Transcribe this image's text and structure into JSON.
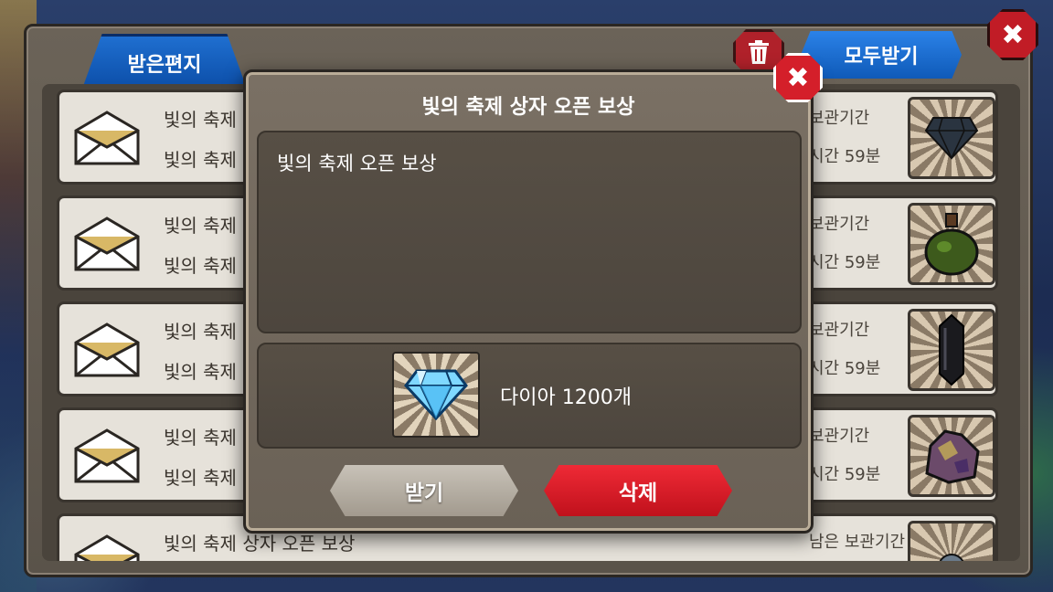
{
  "mailbox": {
    "tab_label": "받은편지",
    "receive_all_label": "모두받기",
    "trash_icon": "trash-icon",
    "close_icon": "close-icon",
    "rows": [
      {
        "title": "빛의 축제",
        "sub": "빛의 축제",
        "keep1": "보관기간",
        "keep2": "시간 59분",
        "item": "dark-gem-icon"
      },
      {
        "title": "빛의 축제",
        "sub": "빛의 축제",
        "keep1": "보관기간",
        "keep2": "시간 59분",
        "item": "green-potion-icon"
      },
      {
        "title": "빛의 축제",
        "sub": "빛의 축제",
        "keep1": "보관기간",
        "keep2": "시간 59분",
        "item": "black-crystal-icon"
      },
      {
        "title": "빛의 축제",
        "sub": "빛의 축제",
        "keep1": "보관기간",
        "keep2": "시간 59분",
        "item": "ore-rock-icon"
      },
      {
        "title": "빛의 축제 상자 오픈 보상",
        "sub": "",
        "keep1": "남은 보관기간",
        "keep2": "",
        "item": "creature-icon"
      }
    ]
  },
  "dialog": {
    "title": "빛의 축제 상자 오픈 보상",
    "message": "빛의 축제 오픈 보상",
    "reward_icon": "diamond-icon",
    "reward_label": "다이아 1200개",
    "receive_label": "받기",
    "delete_label": "삭제",
    "close_icon": "close-icon"
  },
  "colors": {
    "tab_blue": "#1f6fd0",
    "delete_red": "#ef2a36",
    "close_red": "#d41f2a",
    "panel_brown": "#574f45"
  }
}
